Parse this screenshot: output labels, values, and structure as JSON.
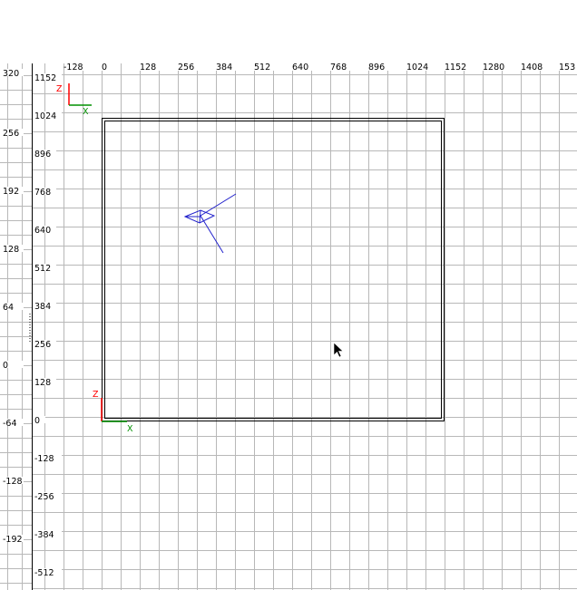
{
  "colors": {
    "background": "#ffffff",
    "grid": "#b8b8b8",
    "border": "#000000",
    "axis_z": "#ff0000",
    "axis_x": "#009000",
    "entity": "#2222cc",
    "text": "#000000"
  },
  "icons": {
    "cursor": "arrow-cursor-icon"
  },
  "left_ruler": {
    "labels": [
      "320",
      "256",
      "192",
      "128",
      "64",
      "0",
      "-64",
      "-128",
      "-192"
    ]
  },
  "viewport": {
    "top_ruler": {
      "labels": [
        "-128",
        "0",
        "128",
        "256",
        "384",
        "512",
        "640",
        "768",
        "896",
        "1024",
        "1152",
        "1280",
        "1408",
        "153"
      ]
    },
    "side_ruler": {
      "labels": [
        "1152",
        "1024",
        "896",
        "768",
        "640",
        "512",
        "384",
        "256",
        "128",
        "0",
        "-128",
        "-256",
        "-384",
        "-512"
      ]
    },
    "mini_axis": {
      "z_label": "Z",
      "x_label": "X"
    },
    "origin_axis": {
      "z_label": "Z",
      "x_label": "X"
    }
  }
}
